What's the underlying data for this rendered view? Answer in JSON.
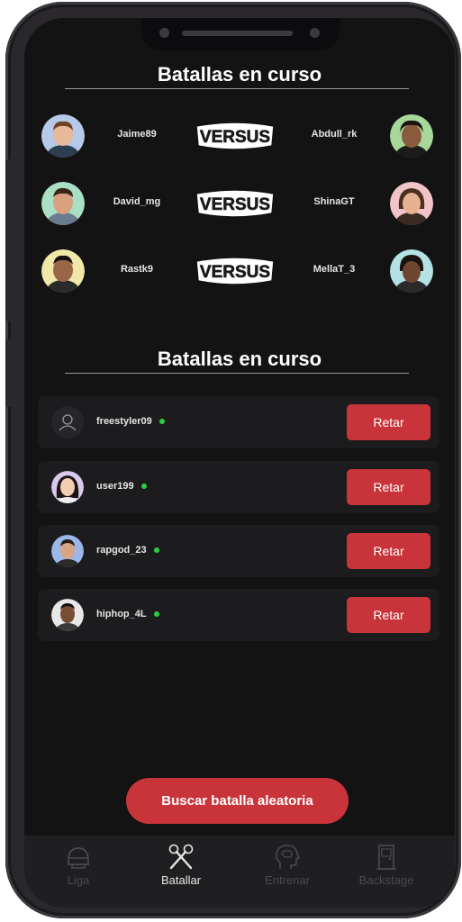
{
  "live_battles": {
    "title": "Batallas en curso",
    "versus_label": "VERSUS",
    "rows": [
      {
        "left": "Jaime89",
        "right": "Abdull_rk"
      },
      {
        "left": "David_mg",
        "right": "ShinaGT"
      },
      {
        "left": "Rastk9",
        "right": "MellaT_3"
      }
    ]
  },
  "challengers": {
    "title": "Batallas en curso",
    "button_label": "Retar",
    "users": [
      {
        "name": "freestyler09",
        "online": true
      },
      {
        "name": "user199",
        "online": true
      },
      {
        "name": "rapgod_23",
        "online": true
      },
      {
        "name": "hiphop_4L",
        "online": true
      }
    ]
  },
  "random_button": "Buscar batalla aleatoria",
  "nav": {
    "items": [
      {
        "label": "Liga",
        "icon": "helmet-icon",
        "active": false
      },
      {
        "label": "Batallar",
        "icon": "crossed-mics-icon",
        "active": true
      },
      {
        "label": "Entrenar",
        "icon": "brain-head-icon",
        "active": false
      },
      {
        "label": "Backstage",
        "icon": "door-icon",
        "active": false
      }
    ]
  },
  "colors": {
    "accent": "#c8343a",
    "background": "#141314",
    "card": "#1c1b1d",
    "online": "#2ecc40"
  }
}
